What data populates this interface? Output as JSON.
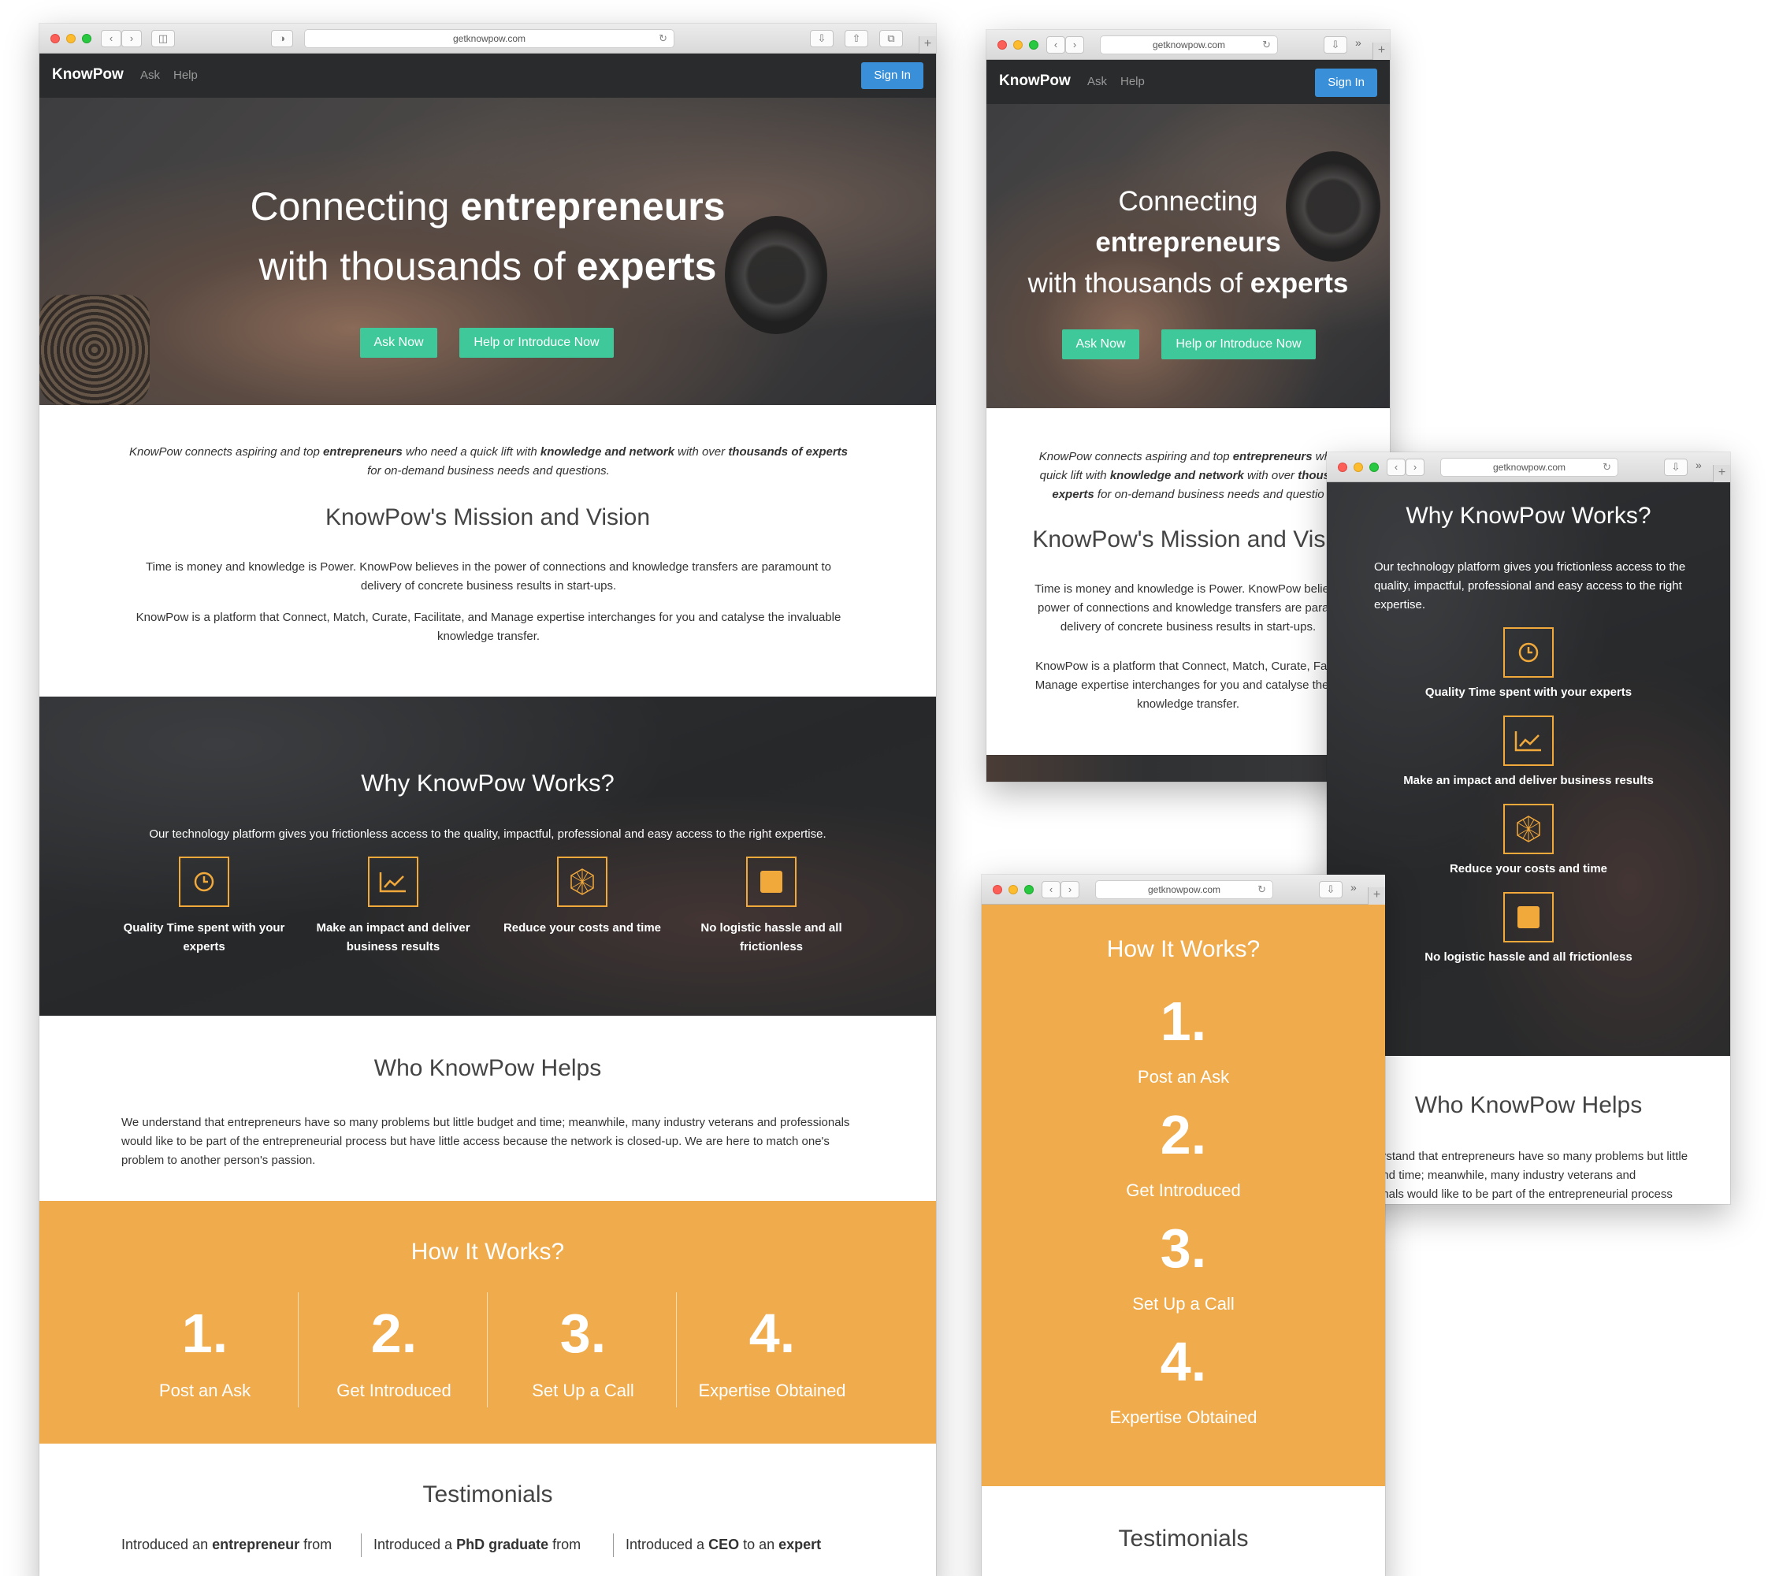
{
  "browser": {
    "url": "getknowpow.com"
  },
  "nav": {
    "brand": "KnowPow",
    "ask": "Ask",
    "help": "Help",
    "signin": "Sign In"
  },
  "hero": {
    "line1_pre": "Connecting ",
    "line1_bold": "entrepreneurs",
    "line2_pre": "with thousands of ",
    "line2_bold": "experts",
    "mobile_line1": "Connecting",
    "mobile_line2": "entrepreneurs",
    "ask_button": "Ask Now",
    "help_button": "Help or Introduce Now"
  },
  "intro": {
    "t1": "KnowPow connects aspiring and top ",
    "b1": "entrepreneurs",
    "t2": " who need a quick lift with ",
    "b2": "knowledge and network",
    "t3": " with over ",
    "b3": "thousands of experts",
    "t4": " for on-demand business needs and questions.",
    "m_line1_pre": "KnowPow connects aspiring and top ",
    "m_line1_bold": "entrepreneurs",
    "m_line1_post": " who",
    "m_line2_pre": "quick lift with ",
    "m_line2_bold": "knowledge and network",
    "m_line2_post": " with over ",
    "m_line2_end": "thousa",
    "m_line3_bold": "experts",
    "m_line3_post": " for on-demand business needs and questio"
  },
  "mission": {
    "title": "KnowPow's Mission and Vision",
    "title_clipped": "KnowPow's Mission and Visio",
    "p1": "Time is money and knowledge is Power. KnowPow believes in the power of connections and knowledge transfers are paramount to delivery of concrete business results in start-ups.",
    "p2": "KnowPow is a platform that Connect, Match, Curate, Facilitate, and Manage expertise interchanges for you and catalyse the invaluable knowledge transfer.",
    "m_p1_l1": "Time is money and knowledge is Power. KnowPow believe",
    "m_p1_l2": "power of connections and knowledge transfers are param",
    "m_p1_l3": "delivery of concrete business results in start-ups.",
    "m_p2_l1": "KnowPow is a platform that Connect, Match, Curate, Facili",
    "m_p2_l2": "Manage expertise interchanges for you and catalyse the in",
    "m_p2_l3": "knowledge transfer."
  },
  "why": {
    "title": "Why KnowPow Works?",
    "subtitle": "Our technology platform gives you frictionless access to the quality, impactful, professional and easy access to the right expertise.",
    "features": [
      {
        "icon": "clock-icon",
        "label": "Quality Time spent with your experts"
      },
      {
        "icon": "chart-up-icon",
        "label": "Make an impact and deliver business results"
      },
      {
        "icon": "polygon-icon",
        "label": "Reduce your costs and time"
      },
      {
        "icon": "square-icon",
        "label": "No logistic hassle and all frictionless"
      }
    ],
    "accent": "#f2a93b"
  },
  "helps": {
    "title": "Who KnowPow Helps",
    "body": "We understand that entrepreneurs have so many problems but little budget and time; meanwhile, many industry veterans and professionals would like to be part of the entrepreneurial process but have little access because the network is closed-up. We are here to match one's problem to another person's passion.",
    "m_l1": "erstand that entrepreneurs have so many problems but little",
    "m_l2": "and time; meanwhile, many industry veterans and",
    "m_l3": "onals would like to be part of the entrepreneurial process"
  },
  "how": {
    "title": "How It Works?",
    "color": "#efab4c",
    "steps": [
      {
        "num": "1.",
        "label": "Post an Ask"
      },
      {
        "num": "2.",
        "label": "Get Introduced"
      },
      {
        "num": "3.",
        "label": "Set Up a Call"
      },
      {
        "num": "4.",
        "label": "Expertise Obtained"
      }
    ]
  },
  "testimonials": {
    "title": "Testimonials",
    "items": [
      {
        "pre": "Introduced an ",
        "bold": "entrepreneur",
        "post": " from"
      },
      {
        "pre": "Introduced a ",
        "bold": "PhD graduate",
        "post": " from"
      },
      {
        "pre": "Introduced a ",
        "bold": "CEO",
        "post": " to an ",
        "bold2": "expert"
      }
    ]
  }
}
